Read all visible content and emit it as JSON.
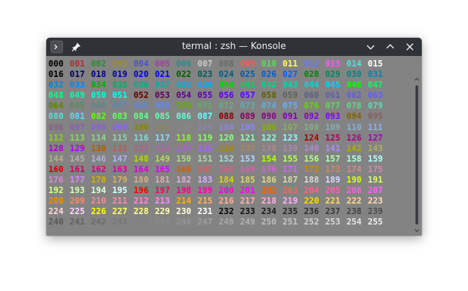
{
  "window": {
    "title": "termal : zsh — Konsole"
  },
  "titlebar_icons": {
    "left": [
      "terminal-icon",
      "pin-icon"
    ],
    "right": [
      "minimize-icon",
      "maximize-icon",
      "close-icon"
    ]
  },
  "prompt": {
    "host": "termal",
    "sign": "$"
  },
  "colors": {
    "background": "#838383",
    "titlebar": "#2f3236"
  },
  "cells": [
    {
      "label": "000",
      "color": "#000000"
    },
    {
      "label": "001",
      "color": "#aa3030"
    },
    {
      "label": "002",
      "color": "#2e8b2e"
    },
    {
      "label": "003",
      "color": "#a08a30"
    },
    {
      "label": "004",
      "color": "#5050c8"
    },
    {
      "label": "005",
      "color": "#a040a0"
    },
    {
      "label": "006",
      "color": "#2a8a8a"
    },
    {
      "label": "007",
      "color": "#c8c8c8"
    },
    {
      "label": "008",
      "color": "#6a6a6a"
    },
    {
      "label": "009",
      "color": "#ff5555"
    },
    {
      "label": "010",
      "color": "#55dd55"
    },
    {
      "label": "011",
      "color": "#ffff55"
    },
    {
      "label": "012",
      "color": "#6677ff"
    },
    {
      "label": "013",
      "color": "#ff55ff"
    },
    {
      "label": "014",
      "color": "#55dddd"
    },
    {
      "label": "015",
      "color": "#ffffff"
    },
    {
      "label": "016",
      "color": "#000000"
    },
    {
      "label": "017",
      "color": "#00005f"
    },
    {
      "label": "018",
      "color": "#000087"
    },
    {
      "label": "019",
      "color": "#0000af"
    },
    {
      "label": "020",
      "color": "#0000d7"
    },
    {
      "label": "021",
      "color": "#0000ff"
    },
    {
      "label": "022",
      "color": "#005f00"
    },
    {
      "label": "023",
      "color": "#005f5f"
    },
    {
      "label": "024",
      "color": "#005f87"
    },
    {
      "label": "025",
      "color": "#005faf"
    },
    {
      "label": "026",
      "color": "#005fd7"
    },
    {
      "label": "027",
      "color": "#005fff"
    },
    {
      "label": "028",
      "color": "#008700"
    },
    {
      "label": "029",
      "color": "#00875f"
    },
    {
      "label": "030",
      "color": "#008787"
    },
    {
      "label": "031",
      "color": "#0087af"
    },
    {
      "label": "032",
      "color": "#0087d7"
    },
    {
      "label": "033",
      "color": "#0087ff"
    },
    {
      "label": "034",
      "color": "#00af00"
    },
    {
      "label": "035",
      "color": "#00af5f"
    },
    {
      "label": "036",
      "color": "#00af87"
    },
    {
      "label": "037",
      "color": "#00afaf"
    },
    {
      "label": "038",
      "color": "#00afd7"
    },
    {
      "label": "039",
      "color": "#00afff"
    },
    {
      "label": "040",
      "color": "#00d700"
    },
    {
      "label": "041",
      "color": "#00d75f"
    },
    {
      "label": "042",
      "color": "#00d787"
    },
    {
      "label": "043",
      "color": "#00d7af"
    },
    {
      "label": "044",
      "color": "#00d7d7"
    },
    {
      "label": "045",
      "color": "#00d7ff"
    },
    {
      "label": "046",
      "color": "#00ff00"
    },
    {
      "label": "047",
      "color": "#00ff5f"
    },
    {
      "label": "048",
      "color": "#00ff87"
    },
    {
      "label": "049",
      "color": "#00ffaf"
    },
    {
      "label": "050",
      "color": "#00ffd7"
    },
    {
      "label": "051",
      "color": "#00ffff"
    },
    {
      "label": "052",
      "color": "#5f0000"
    },
    {
      "label": "053",
      "color": "#5f005f"
    },
    {
      "label": "054",
      "color": "#5f0087"
    },
    {
      "label": "055",
      "color": "#5f00af"
    },
    {
      "label": "056",
      "color": "#5f00d7"
    },
    {
      "label": "057",
      "color": "#5f00ff"
    },
    {
      "label": "058",
      "color": "#5f5f00"
    },
    {
      "label": "059",
      "color": "#5f5f5f"
    },
    {
      "label": "060",
      "color": "#5f5f87"
    },
    {
      "label": "061",
      "color": "#5f5faf"
    },
    {
      "label": "062",
      "color": "#5f5fd7"
    },
    {
      "label": "063",
      "color": "#5f5fff"
    },
    {
      "label": "064",
      "color": "#5f8700"
    },
    {
      "label": "065",
      "color": "#5f875f"
    },
    {
      "label": "066",
      "color": "#5f8787"
    },
    {
      "label": "067",
      "color": "#5f87af"
    },
    {
      "label": "068",
      "color": "#5f87d7"
    },
    {
      "label": "069",
      "color": "#5f87ff"
    },
    {
      "label": "070",
      "color": "#5faf00"
    },
    {
      "label": "071",
      "color": "#5faf5f"
    },
    {
      "label": "072",
      "color": "#5faf87"
    },
    {
      "label": "073",
      "color": "#5fafaf"
    },
    {
      "label": "074",
      "color": "#5fafd7"
    },
    {
      "label": "075",
      "color": "#5fafff"
    },
    {
      "label": "076",
      "color": "#5fd700"
    },
    {
      "label": "077",
      "color": "#5fd75f"
    },
    {
      "label": "078",
      "color": "#5fd787"
    },
    {
      "label": "079",
      "color": "#5fd7af"
    },
    {
      "label": "080",
      "color": "#5fd7d7"
    },
    {
      "label": "081",
      "color": "#5fd7ff"
    },
    {
      "label": "082",
      "color": "#5fff00"
    },
    {
      "label": "083",
      "color": "#5fff5f"
    },
    {
      "label": "084",
      "color": "#5fff87"
    },
    {
      "label": "085",
      "color": "#5fffaf"
    },
    {
      "label": "086",
      "color": "#5fffd7"
    },
    {
      "label": "087",
      "color": "#5fffff"
    },
    {
      "label": "088",
      "color": "#870000"
    },
    {
      "label": "089",
      "color": "#87005f"
    },
    {
      "label": "090",
      "color": "#870087"
    },
    {
      "label": "091",
      "color": "#8700af"
    },
    {
      "label": "092",
      "color": "#8700d7"
    },
    {
      "label": "093",
      "color": "#8700ff"
    },
    {
      "label": "094",
      "color": "#875f00"
    },
    {
      "label": "095",
      "color": "#875f5f"
    },
    {
      "label": "096",
      "color": "#875f87"
    },
    {
      "label": "097",
      "color": "#875faf"
    },
    {
      "label": "098",
      "color": "#875fd7"
    },
    {
      "label": "099",
      "color": "#875fff"
    },
    {
      "label": "100",
      "color": "#878700"
    },
    {
      "label": "101",
      "color": "#87875f"
    },
    {
      "label": "102",
      "color": "#878787"
    },
    {
      "label": "103",
      "color": "#8787af"
    },
    {
      "label": "104",
      "color": "#8787d7"
    },
    {
      "label": "105",
      "color": "#8787ff"
    },
    {
      "label": "106",
      "color": "#87af00"
    },
    {
      "label": "107",
      "color": "#87af5f"
    },
    {
      "label": "108",
      "color": "#87af87"
    },
    {
      "label": "109",
      "color": "#87afaf"
    },
    {
      "label": "110",
      "color": "#87afd7"
    },
    {
      "label": "111",
      "color": "#87afff"
    },
    {
      "label": "112",
      "color": "#87d700"
    },
    {
      "label": "113",
      "color": "#87d75f"
    },
    {
      "label": "114",
      "color": "#87d787"
    },
    {
      "label": "115",
      "color": "#87d7af"
    },
    {
      "label": "116",
      "color": "#87d7d7"
    },
    {
      "label": "117",
      "color": "#87d7ff"
    },
    {
      "label": "118",
      "color": "#87ff00"
    },
    {
      "label": "119",
      "color": "#87ff5f"
    },
    {
      "label": "120",
      "color": "#87ff87"
    },
    {
      "label": "121",
      "color": "#87ffaf"
    },
    {
      "label": "122",
      "color": "#87ffd7"
    },
    {
      "label": "123",
      "color": "#87ffff"
    },
    {
      "label": "124",
      "color": "#af0000"
    },
    {
      "label": "125",
      "color": "#af005f"
    },
    {
      "label": "126",
      "color": "#af0087"
    },
    {
      "label": "127",
      "color": "#af00af"
    },
    {
      "label": "128",
      "color": "#af00d7"
    },
    {
      "label": "129",
      "color": "#af00ff"
    },
    {
      "label": "130",
      "color": "#af5f00"
    },
    {
      "label": "131",
      "color": "#af5f5f"
    },
    {
      "label": "132",
      "color": "#af5f87"
    },
    {
      "label": "133",
      "color": "#af5faf"
    },
    {
      "label": "134",
      "color": "#af5fd7"
    },
    {
      "label": "135",
      "color": "#af5fff"
    },
    {
      "label": "136",
      "color": "#af8700"
    },
    {
      "label": "137",
      "color": "#af875f"
    },
    {
      "label": "138",
      "color": "#af8787"
    },
    {
      "label": "139",
      "color": "#af87af"
    },
    {
      "label": "140",
      "color": "#af87d7"
    },
    {
      "label": "141",
      "color": "#af87ff"
    },
    {
      "label": "142",
      "color": "#afaf00"
    },
    {
      "label": "143",
      "color": "#afaf5f"
    },
    {
      "label": "144",
      "color": "#afaf87"
    },
    {
      "label": "145",
      "color": "#afafaf"
    },
    {
      "label": "146",
      "color": "#afafd7"
    },
    {
      "label": "147",
      "color": "#afafff"
    },
    {
      "label": "148",
      "color": "#afd700"
    },
    {
      "label": "149",
      "color": "#afd75f"
    },
    {
      "label": "150",
      "color": "#afd787"
    },
    {
      "label": "151",
      "color": "#afd7af"
    },
    {
      "label": "152",
      "color": "#afd7d7"
    },
    {
      "label": "153",
      "color": "#afd7ff"
    },
    {
      "label": "154",
      "color": "#afff00"
    },
    {
      "label": "155",
      "color": "#afff5f"
    },
    {
      "label": "156",
      "color": "#afff87"
    },
    {
      "label": "157",
      "color": "#afffaf"
    },
    {
      "label": "158",
      "color": "#afffd7"
    },
    {
      "label": "159",
      "color": "#afffff"
    },
    {
      "label": "160",
      "color": "#d70000"
    },
    {
      "label": "161",
      "color": "#d7005f"
    },
    {
      "label": "162",
      "color": "#d70087"
    },
    {
      "label": "163",
      "color": "#d700af"
    },
    {
      "label": "164",
      "color": "#d700d7"
    },
    {
      "label": "165",
      "color": "#d700ff"
    },
    {
      "label": "166",
      "color": "#d75f00"
    },
    {
      "label": "167",
      "color": "#d75f5f"
    },
    {
      "label": "168",
      "color": "#d75f87"
    },
    {
      "label": "169",
      "color": "#d75faf"
    },
    {
      "label": "170",
      "color": "#d75fd7"
    },
    {
      "label": "171",
      "color": "#d75fff"
    },
    {
      "label": "172",
      "color": "#d78700"
    },
    {
      "label": "173",
      "color": "#d7875f"
    },
    {
      "label": "174",
      "color": "#d78787"
    },
    {
      "label": "175",
      "color": "#d787af"
    },
    {
      "label": "176",
      "color": "#d787d7"
    },
    {
      "label": "177",
      "color": "#d787ff"
    },
    {
      "label": "178",
      "color": "#d7af00"
    },
    {
      "label": "179",
      "color": "#d7af5f"
    },
    {
      "label": "180",
      "color": "#d7af87"
    },
    {
      "label": "181",
      "color": "#d7afaf"
    },
    {
      "label": "182",
      "color": "#d7afd7"
    },
    {
      "label": "183",
      "color": "#d7afff"
    },
    {
      "label": "184",
      "color": "#d7d700"
    },
    {
      "label": "185",
      "color": "#d7d75f"
    },
    {
      "label": "186",
      "color": "#d7d787"
    },
    {
      "label": "187",
      "color": "#d7d7af"
    },
    {
      "label": "188",
      "color": "#d7d7d7"
    },
    {
      "label": "189",
      "color": "#d7d7ff"
    },
    {
      "label": "190",
      "color": "#d7ff00"
    },
    {
      "label": "191",
      "color": "#d7ff5f"
    },
    {
      "label": "192",
      "color": "#d7ff87"
    },
    {
      "label": "193",
      "color": "#d7ffaf"
    },
    {
      "label": "194",
      "color": "#d7ffd7"
    },
    {
      "label": "195",
      "color": "#d7ffff"
    },
    {
      "label": "196",
      "color": "#ff0000"
    },
    {
      "label": "197",
      "color": "#ff005f"
    },
    {
      "label": "198",
      "color": "#ff0087"
    },
    {
      "label": "199",
      "color": "#ff00af"
    },
    {
      "label": "200",
      "color": "#ff00d7"
    },
    {
      "label": "201",
      "color": "#ff00ff"
    },
    {
      "label": "202",
      "color": "#ff5f00"
    },
    {
      "label": "203",
      "color": "#ff5f5f"
    },
    {
      "label": "204",
      "color": "#ff5f87"
    },
    {
      "label": "205",
      "color": "#ff5faf"
    },
    {
      "label": "206",
      "color": "#ff5fd7"
    },
    {
      "label": "207",
      "color": "#ff5fff"
    },
    {
      "label": "208",
      "color": "#ff8700"
    },
    {
      "label": "209",
      "color": "#ff875f"
    },
    {
      "label": "210",
      "color": "#ff8787"
    },
    {
      "label": "211",
      "color": "#ff87af"
    },
    {
      "label": "212",
      "color": "#ff87d7"
    },
    {
      "label": "213",
      "color": "#ff87ff"
    },
    {
      "label": "214",
      "color": "#ffaf00"
    },
    {
      "label": "215",
      "color": "#ffaf5f"
    },
    {
      "label": "216",
      "color": "#ffaf87"
    },
    {
      "label": "217",
      "color": "#ffafaf"
    },
    {
      "label": "218",
      "color": "#ffafd7"
    },
    {
      "label": "219",
      "color": "#ffafff"
    },
    {
      "label": "220",
      "color": "#ffd700"
    },
    {
      "label": "221",
      "color": "#ffd75f"
    },
    {
      "label": "222",
      "color": "#ffd787"
    },
    {
      "label": "223",
      "color": "#ffd7af"
    },
    {
      "label": "224",
      "color": "#ffd7d7"
    },
    {
      "label": "225",
      "color": "#ffd7ff"
    },
    {
      "label": "226",
      "color": "#ffff00"
    },
    {
      "label": "227",
      "color": "#ffff5f"
    },
    {
      "label": "228",
      "color": "#ffff87"
    },
    {
      "label": "229",
      "color": "#ffffaf"
    },
    {
      "label": "230",
      "color": "#ffffd7"
    },
    {
      "label": "231",
      "color": "#ffffff"
    },
    {
      "label": "232",
      "color": "#080808"
    },
    {
      "label": "233",
      "color": "#121212"
    },
    {
      "label": "234",
      "color": "#1c1c1c"
    },
    {
      "label": "235",
      "color": "#262626"
    },
    {
      "label": "236",
      "color": "#303030"
    },
    {
      "label": "237",
      "color": "#3a3a3a"
    },
    {
      "label": "238",
      "color": "#444444"
    },
    {
      "label": "239",
      "color": "#4e4e4e"
    },
    {
      "label": "240",
      "color": "#585858"
    },
    {
      "label": "241",
      "color": "#626262"
    },
    {
      "label": "242",
      "color": "#6c6c6c"
    },
    {
      "label": "243",
      "color": "#767676"
    },
    {
      "label": "244",
      "color": "#808080"
    },
    {
      "label": "245",
      "color": "#8a8a8a"
    },
    {
      "label": "246",
      "color": "#949494"
    },
    {
      "label": "247",
      "color": "#9e9e9e"
    },
    {
      "label": "248",
      "color": "#a8a8a8"
    },
    {
      "label": "249",
      "color": "#b2b2b2"
    },
    {
      "label": "250",
      "color": "#bcbcbc"
    },
    {
      "label": "251",
      "color": "#c6c6c6"
    },
    {
      "label": "252",
      "color": "#d0d0d0"
    },
    {
      "label": "253",
      "color": "#dadada"
    },
    {
      "label": "254",
      "color": "#e4e4e4"
    },
    {
      "label": "255",
      "color": "#eeeeee"
    }
  ]
}
